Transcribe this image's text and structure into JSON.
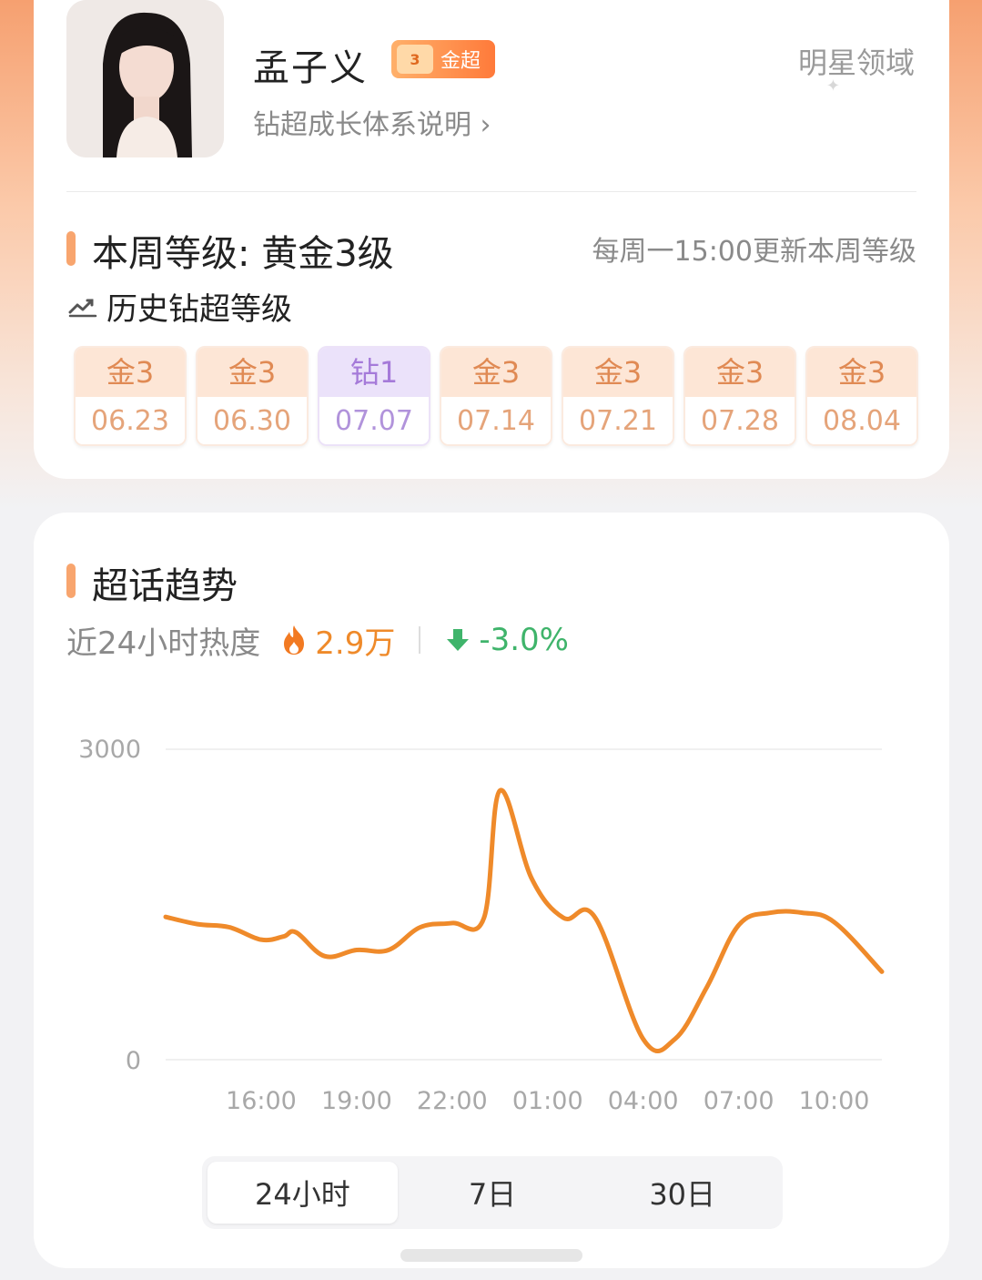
{
  "profile": {
    "name": "孟子义",
    "badge_number": "3",
    "badge_label": "金超",
    "realm": "明星领域",
    "growth_link": "钻超成长体系说明 ›"
  },
  "level": {
    "current": "本周等级: 黄金3级",
    "update_note": "每周一15:00更新本周等级",
    "history_title": "历史钻超等级",
    "history": [
      {
        "level": "金3",
        "date": "06.23",
        "tier": "gold"
      },
      {
        "level": "金3",
        "date": "06.30",
        "tier": "gold"
      },
      {
        "level": "钻1",
        "date": "07.07",
        "tier": "diamond"
      },
      {
        "level": "金3",
        "date": "07.14",
        "tier": "gold"
      },
      {
        "level": "金3",
        "date": "07.21",
        "tier": "gold"
      },
      {
        "level": "金3",
        "date": "07.28",
        "tier": "gold"
      },
      {
        "level": "金3",
        "date": "08.04",
        "tier": "gold"
      }
    ]
  },
  "trend": {
    "title": "超话趋势",
    "heat_label": "近24小时热度",
    "heat_value": "2.9万",
    "change": "-3.0%",
    "heat_color": "#ef8a2a",
    "change_color": "#3fb46b",
    "tabs": [
      "24小时",
      "7日",
      "30日"
    ],
    "active_tab": "24小时"
  },
  "chart_data": {
    "type": "line",
    "line_color": "#ef8a2a",
    "ylim": [
      0,
      3000
    ],
    "y_ticks": [
      "3000",
      "0"
    ],
    "x_ticks": [
      "16:00",
      "19:00",
      "22:00",
      "01:00",
      "04:00",
      "07:00",
      "10:00"
    ],
    "x_tick_hours": [
      3,
      6,
      9,
      12,
      15,
      18,
      21
    ],
    "points": [
      [
        0,
        1380
      ],
      [
        1,
        1310
      ],
      [
        2,
        1280
      ],
      [
        3,
        1160
      ],
      [
        3.7,
        1190
      ],
      [
        4.1,
        1230
      ],
      [
        5,
        1000
      ],
      [
        6,
        1060
      ],
      [
        7,
        1060
      ],
      [
        8,
        1280
      ],
      [
        9,
        1320
      ],
      [
        10,
        1370
      ],
      [
        10.5,
        2600
      ],
      [
        11.5,
        1750
      ],
      [
        12.5,
        1370
      ],
      [
        13.5,
        1370
      ],
      [
        15,
        200
      ],
      [
        16,
        200
      ],
      [
        17,
        700
      ],
      [
        18,
        1300
      ],
      [
        19,
        1420
      ],
      [
        20,
        1420
      ],
      [
        21,
        1330
      ],
      [
        22.5,
        850
      ]
    ]
  }
}
